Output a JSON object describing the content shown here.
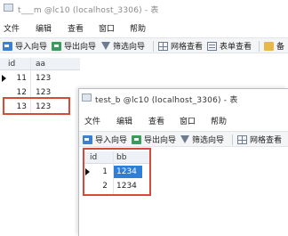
{
  "back_window": {
    "title": "t___m @lc10 (localhost_3306) - 表",
    "menu": [
      "文件",
      "编辑",
      "查看",
      "窗口",
      "帮助"
    ],
    "toolbar": [
      {
        "label": "导入向导",
        "icon": "import-icon"
      },
      {
        "label": "导出向导",
        "icon": "export-icon"
      },
      {
        "label": "筛选向导",
        "icon": "filter-icon"
      },
      {
        "label": "网格查看",
        "icon": "grid-icon"
      },
      {
        "label": "表单查看",
        "icon": "form-icon"
      },
      {
        "label": "备",
        "icon": "note-icon"
      }
    ],
    "columns": [
      "id",
      "aa"
    ],
    "rows": [
      {
        "id": "11",
        "aa": "123"
      },
      {
        "id": "12",
        "aa": "123"
      },
      {
        "id": "13",
        "aa": "123"
      }
    ]
  },
  "front_window": {
    "title": "test_b @lc10 (localhost_3306) - 表",
    "menu": [
      "文件",
      "编辑",
      "查看",
      "窗口",
      "帮助"
    ],
    "toolbar": [
      {
        "label": "导入向导",
        "icon": "import-icon"
      },
      {
        "label": "导出向导",
        "icon": "export-icon"
      },
      {
        "label": "筛选向导",
        "icon": "filter-icon"
      },
      {
        "label": "网格查看",
        "icon": "grid-icon"
      }
    ],
    "columns": [
      "id",
      "bb"
    ],
    "rows": [
      {
        "id": "1",
        "bb": "1234"
      },
      {
        "id": "2",
        "bb": "1234"
      }
    ]
  },
  "highlight_color": "#d64a3a",
  "selection_color": "#2f7fd6"
}
